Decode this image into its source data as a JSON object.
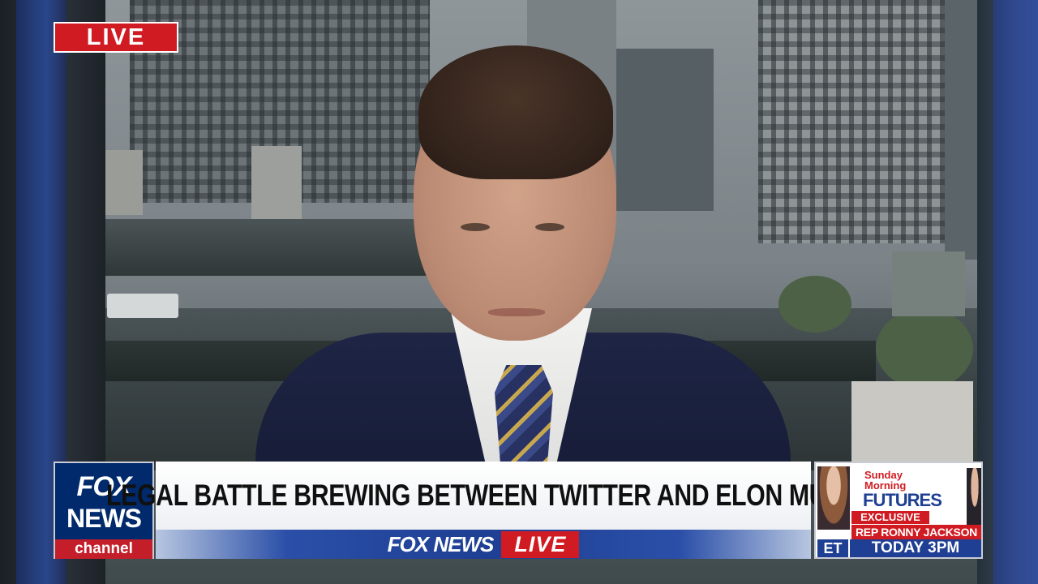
{
  "live_badge": "LIVE",
  "logo": {
    "line1": "FOX",
    "line2": "NEWS",
    "line3": "channel"
  },
  "headline": "LEGAL BATTLE BREWING BETWEEN TWITTER AND ELON MUSK",
  "brand_bar": {
    "network": "FOX NEWS",
    "live": "LIVE"
  },
  "promo": {
    "show_line1": "Sunday",
    "show_line2": "Morning",
    "show_line3": "FUTURES",
    "tag": "EXCLUSIVE",
    "guest": "REP RONNY JACKSON",
    "timezone": "ET",
    "time": "TODAY 3PM"
  },
  "colors": {
    "fox_red": "#d11b22",
    "fox_blue": "#1e3f93",
    "fox_navy": "#002a6b"
  }
}
